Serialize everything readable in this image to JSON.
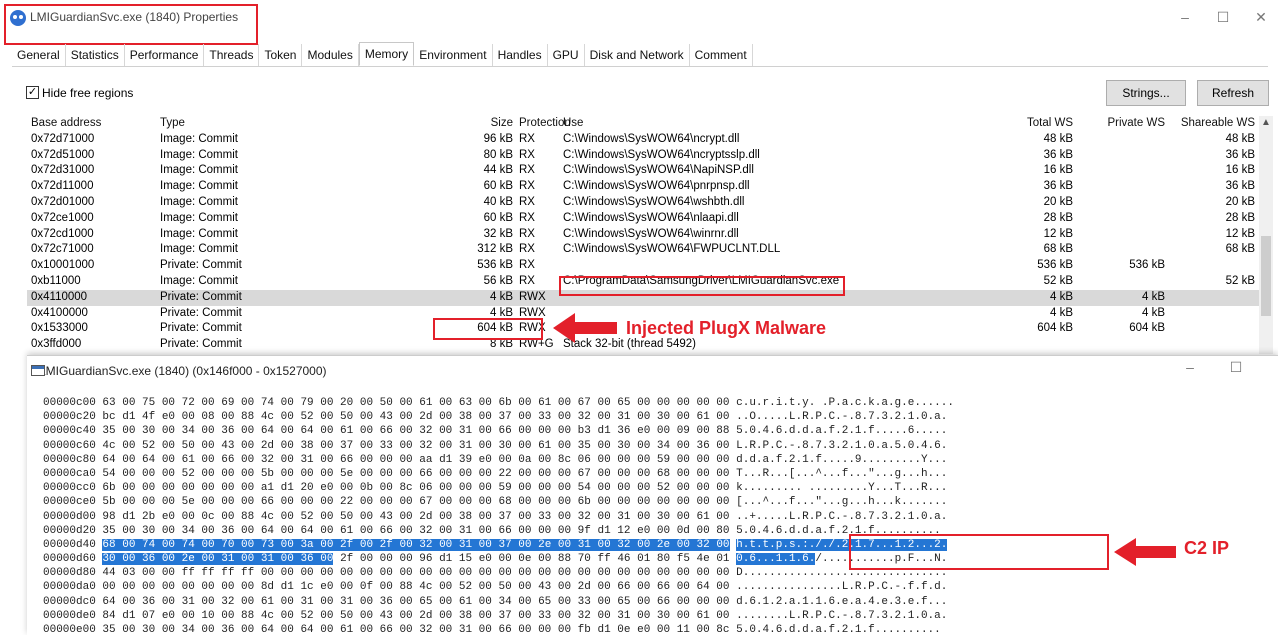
{
  "window": {
    "title": "LMIGuardianSvc.exe (1840) Properties",
    "minimize": "–",
    "maximize": "☐",
    "close": "✕"
  },
  "tabs": [
    "General",
    "Statistics",
    "Performance",
    "Threads",
    "Token",
    "Modules",
    "Memory",
    "Environment",
    "Handles",
    "GPU",
    "Disk and Network",
    "Comment"
  ],
  "active_tab": "Memory",
  "toolbar": {
    "hide_free_label": "Hide free regions",
    "hide_free_checked": true,
    "strings_label": "Strings...",
    "refresh_label": "Refresh"
  },
  "columns": {
    "base": "Base address",
    "type": "Type",
    "size": "Size",
    "protection": "Protection",
    "use": "Use",
    "total_ws": "Total WS",
    "private_ws": "Private WS",
    "shareable_ws": "Shareable WS"
  },
  "rows": [
    {
      "base": "0x72d71000",
      "type": "Image: Commit",
      "size": "96 kB",
      "prot": "RX",
      "use": "C:\\Windows\\SysWOW64\\ncrypt.dll",
      "tws": "48 kB",
      "pws": "",
      "sws": "48 kB"
    },
    {
      "base": "0x72d51000",
      "type": "Image: Commit",
      "size": "80 kB",
      "prot": "RX",
      "use": "C:\\Windows\\SysWOW64\\ncryptsslp.dll",
      "tws": "36 kB",
      "pws": "",
      "sws": "36 kB"
    },
    {
      "base": "0x72d31000",
      "type": "Image: Commit",
      "size": "44 kB",
      "prot": "RX",
      "use": "C:\\Windows\\SysWOW64\\NapiNSP.dll",
      "tws": "16 kB",
      "pws": "",
      "sws": "16 kB"
    },
    {
      "base": "0x72d11000",
      "type": "Image: Commit",
      "size": "60 kB",
      "prot": "RX",
      "use": "C:\\Windows\\SysWOW64\\pnrpnsp.dll",
      "tws": "36 kB",
      "pws": "",
      "sws": "36 kB"
    },
    {
      "base": "0x72d01000",
      "type": "Image: Commit",
      "size": "40 kB",
      "prot": "RX",
      "use": "C:\\Windows\\SysWOW64\\wshbth.dll",
      "tws": "20 kB",
      "pws": "",
      "sws": "20 kB"
    },
    {
      "base": "0x72ce1000",
      "type": "Image: Commit",
      "size": "60 kB",
      "prot": "RX",
      "use": "C:\\Windows\\SysWOW64\\nlaapi.dll",
      "tws": "28 kB",
      "pws": "",
      "sws": "28 kB"
    },
    {
      "base": "0x72cd1000",
      "type": "Image: Commit",
      "size": "32 kB",
      "prot": "RX",
      "use": "C:\\Windows\\SysWOW64\\winrnr.dll",
      "tws": "12 kB",
      "pws": "",
      "sws": "12 kB"
    },
    {
      "base": "0x72c71000",
      "type": "Image: Commit",
      "size": "312 kB",
      "prot": "RX",
      "use": "C:\\Windows\\SysWOW64\\FWPUCLNT.DLL",
      "tws": "68 kB",
      "pws": "",
      "sws": "68 kB"
    },
    {
      "base": "0x10001000",
      "type": "Private: Commit",
      "size": "536 kB",
      "prot": "RX",
      "use": "",
      "tws": "536 kB",
      "pws": "536 kB",
      "sws": ""
    },
    {
      "base": "0xb11000",
      "type": "Image: Commit",
      "size": "56 kB",
      "prot": "RX",
      "use": "C:\\ProgramData\\SamsungDriver\\LMIGuardianSvc.exe",
      "tws": "52 kB",
      "pws": "",
      "sws": "52 kB"
    },
    {
      "base": "0x4110000",
      "type": "Private: Commit",
      "size": "4 kB",
      "prot": "RWX",
      "use": "",
      "tws": "4 kB",
      "pws": "4 kB",
      "sws": ""
    },
    {
      "base": "0x4100000",
      "type": "Private: Commit",
      "size": "4 kB",
      "prot": "RWX",
      "use": "",
      "tws": "4 kB",
      "pws": "4 kB",
      "sws": ""
    },
    {
      "base": "0x1533000",
      "type": "Private: Commit",
      "size": "604 kB",
      "prot": "RWX",
      "use": "",
      "tws": "604 kB",
      "pws": "604 kB",
      "sws": ""
    },
    {
      "base": "0x3ffd000",
      "type": "Private: Commit",
      "size": "8 kB",
      "prot": "RW+G",
      "use": "Stack 32-bit (thread 5492)",
      "tws": "",
      "pws": "",
      "sws": ""
    }
  ],
  "selected_row": 10,
  "annotations": {
    "injected": "Injected PlugX Malware",
    "c2": "C2 IP"
  },
  "hex_window": {
    "title": "LMIGuardianSvc.exe (1840) (0x146f000 - 0x1527000)",
    "minimize": "–",
    "maximize": "☐",
    "lines": [
      {
        "pre": "00000c00 63 00 75 00 72 00 69 00 74 00 79 00 20 00 50 00 61 00 63 00 6b 00 61 00 67 00 65 00 00 00 00 00 c.u.r.i.t.y. .P.a.c.k.a.g.e......",
        "sel": "",
        "post": ""
      },
      {
        "pre": "00000c20 bc d1 4f e0 00 08 00 88 4c 00 52 00 50 00 43 00 2d 00 38 00 37 00 33 00 32 00 31 00 30 00 61 00 ..O.....L.R.P.C.-.8.7.3.2.1.0.a.",
        "sel": "",
        "post": ""
      },
      {
        "pre": "00000c40 35 00 30 00 34 00 36 00 64 00 64 00 61 00 66 00 32 00 31 00 66 00 00 00 b3 d1 36 e0 00 09 00 88 5.0.4.6.d.d.a.f.2.1.f.....6.....",
        "sel": "",
        "post": ""
      },
      {
        "pre": "00000c60 4c 00 52 00 50 00 43 00 2d 00 38 00 37 00 33 00 32 00 31 00 30 00 61 00 35 00 30 00 34 00 36 00 L.R.P.C.-.8.7.3.2.1.0.a.5.0.4.6.",
        "sel": "",
        "post": ""
      },
      {
        "pre": "00000c80 64 00 64 00 61 00 66 00 32 00 31 00 66 00 00 00 aa d1 39 e0 00 0a 00 8c 06 00 00 00 59 00 00 00 d.d.a.f.2.1.f.....9.........Y...",
        "sel": "",
        "post": ""
      },
      {
        "pre": "00000ca0 54 00 00 00 52 00 00 00 5b 00 00 00 5e 00 00 00 66 00 00 00 22 00 00 00 67 00 00 00 68 00 00 00 T...R...[...^...f...\"...g...h...",
        "sel": "",
        "post": ""
      },
      {
        "pre": "00000cc0 6b 00 00 00 00 00 00 00 a1 d1 20 e0 00 0b 00 8c 06 00 00 00 59 00 00 00 54 00 00 00 52 00 00 00 k......... .........Y...T...R...",
        "sel": "",
        "post": ""
      },
      {
        "pre": "00000ce0 5b 00 00 00 5e 00 00 00 66 00 00 00 22 00 00 00 67 00 00 00 68 00 00 00 6b 00 00 00 00 00 00 00 [...^...f...\"...g...h...k.......",
        "sel": "",
        "post": ""
      },
      {
        "pre": "00000d00 98 d1 2b e0 00 0c 00 88 4c 00 52 00 50 00 43 00 2d 00 38 00 37 00 33 00 32 00 31 00 30 00 61 00 ..+.....L.R.P.C.-.8.7.3.2.1.0.a.",
        "sel": "",
        "post": ""
      },
      {
        "pre": "00000d20 35 00 30 00 34 00 36 00 64 00 64 00 61 00 66 00 32 00 31 00 66 00 00 00 9f d1 12 e0 00 0d 00 80 5.0.4.6.d.d.a.f.2.1.f..........",
        "sel": "",
        "post": ""
      },
      {
        "pre": "00000d40 ",
        "sel": "68 00 74 00 74 00 70 00 73 00 3a 00 2f 00 2f 00 32 00 31 00 37 00 2e 00 31 00 32 00 2e 00 32 00",
        "mid": " ",
        "sel2": "h.t.t.p.s.:././.2.1.7...1.2...2.",
        "post": ""
      },
      {
        "pre": "00000d60 ",
        "sel": "30 00 36 00 2e 00 31 00 31 00 36 00",
        "mid": " 2f 00 00 00 96 d1 15 e0 00 0e 00 88 70 ff 46 01 80 f5 4e 01 ",
        "sel2": "0.6...1.1.6.",
        "post": "/...........p.F...N."
      },
      {
        "pre": "00000d80 44 03 00 00 ff ff ff ff 00 00 00 00 00 00 00 00 00 00 00 00 00 00 00 00 00 00 00 00 00 00 00 00 D...............................",
        "sel": "",
        "post": ""
      },
      {
        "pre": "00000da0 00 00 00 00 00 00 00 00 8d d1 1c e0 00 0f 00 88 4c 00 52 00 50 00 43 00 2d 00 66 00 66 00 64 00 ................L.R.P.C.-.f.f.d.",
        "sel": "",
        "post": ""
      },
      {
        "pre": "00000dc0 64 00 36 00 31 00 32 00 61 00 31 00 31 00 36 00 65 00 61 00 34 00 65 00 33 00 65 00 66 00 00 00 d.6.1.2.a.1.1.6.e.a.4.e.3.e.f...",
        "sel": "",
        "post": ""
      },
      {
        "pre": "00000de0 84 d1 07 e0 00 10 00 88 4c 00 52 00 50 00 43 00 2d 00 38 00 37 00 33 00 32 00 31 00 30 00 61 00 ........L.R.P.C.-.8.7.3.2.1.0.a.",
        "sel": "",
        "post": ""
      },
      {
        "pre": "00000e00 35 00 30 00 34 00 36 00 64 00 64 00 61 00 66 00 32 00 31 00 66 00 00 00 fb d1 0e e0 00 11 00 8c 5.0.4.6.d.d.a.f.2.1.f..........",
        "sel": "",
        "post": ""
      }
    ]
  },
  "colors": {
    "highlight_red": "#e3202a",
    "selection_blue": "#2476d4",
    "row_selected": "#d9d9d9"
  }
}
